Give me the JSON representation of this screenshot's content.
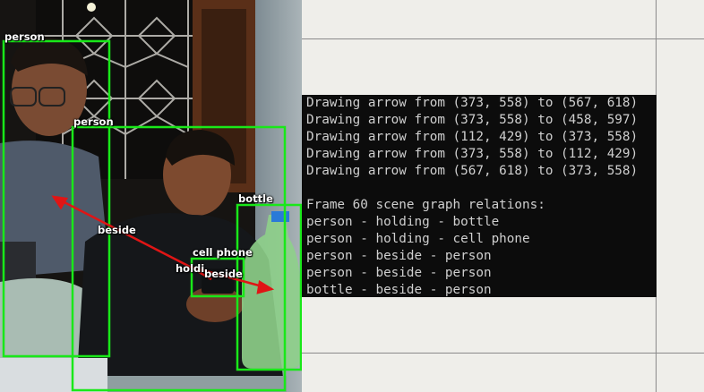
{
  "detections": {
    "labels": [
      "person",
      "person",
      "bottle",
      "cell phone"
    ],
    "box_color": "#19e819",
    "arrow_color": "#e01515"
  },
  "relation_labels": [
    "beside",
    "holdi",
    "beside"
  ],
  "terminal": {
    "lines": [
      "Drawing arrow from (373, 558) to (567, 618)",
      "Drawing arrow from (373, 558) to (458, 597)",
      "Drawing arrow from (112, 429) to (373, 558)",
      "Drawing arrow from (373, 558) to (112, 429)",
      "Drawing arrow from (567, 618) to (373, 558)",
      "",
      "Frame 60 scene graph relations:",
      "person - holding - bottle",
      "person - holding - cell phone",
      "person - beside - person",
      "person - beside - person",
      "bottle - beside - person"
    ]
  }
}
